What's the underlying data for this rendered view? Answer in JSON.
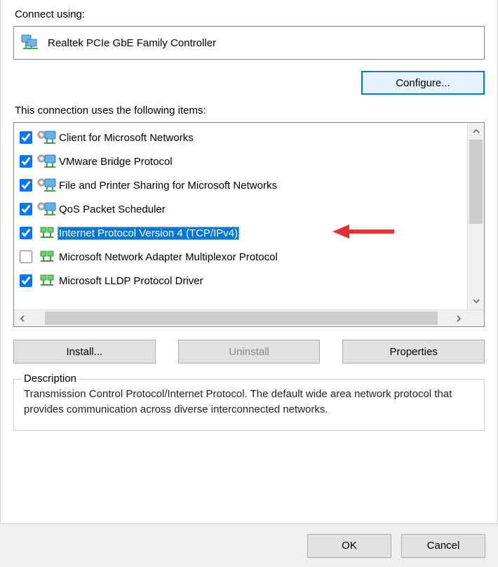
{
  "connectUsingLabel": "Connect using:",
  "adapterName": "Realtek PCIe GbE Family Controller",
  "configureLabel": "Configure...",
  "itemsLabel": "This connection uses the following items:",
  "items": [
    {
      "label": "Client for Microsoft Networks",
      "checked": true,
      "selected": false,
      "iconType": "gear-net"
    },
    {
      "label": "VMware Bridge Protocol",
      "checked": true,
      "selected": false,
      "iconType": "gear-net"
    },
    {
      "label": "File and Printer Sharing for Microsoft Networks",
      "checked": true,
      "selected": false,
      "iconType": "gear-net"
    },
    {
      "label": "QoS Packet Scheduler",
      "checked": true,
      "selected": false,
      "iconType": "gear-net"
    },
    {
      "label": "Internet Protocol Version 4 (TCP/IPv4)",
      "checked": true,
      "selected": true,
      "iconType": "net-small"
    },
    {
      "label": "Microsoft Network Adapter Multiplexor Protocol",
      "checked": false,
      "selected": false,
      "iconType": "net-small"
    },
    {
      "label": "Microsoft LLDP Protocol Driver",
      "checked": true,
      "selected": false,
      "iconType": "net-small"
    }
  ],
  "installLabel": "Install...",
  "uninstallLabel": "Uninstall",
  "propertiesLabel": "Properties",
  "descriptionLegend": "Description",
  "descriptionText": "Transmission Control Protocol/Internet Protocol. The default wide area network protocol that provides communication across diverse interconnected networks.",
  "okLabel": "OK",
  "cancelLabel": "Cancel"
}
